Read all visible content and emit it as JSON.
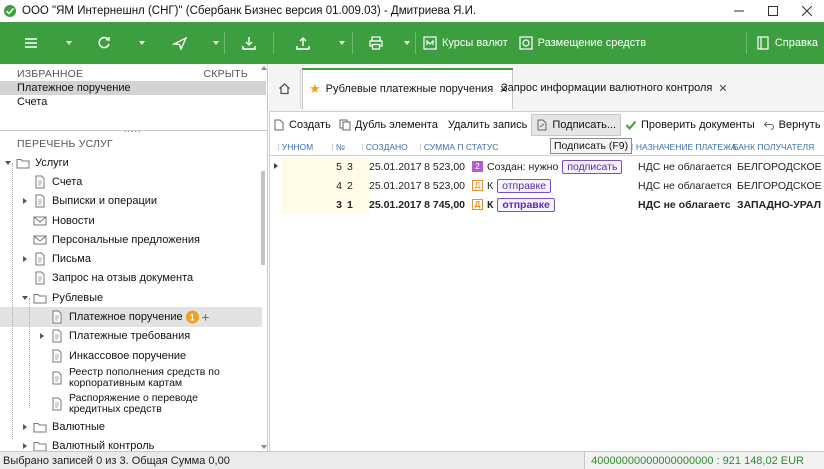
{
  "window": {
    "title": "ООО \"ЯМ Интернешнл (СНГ)\" (Сбербанк Бизнес версия 01.009.03) - Дмитриева Я.И.",
    "controls": [
      "minimize",
      "maximize",
      "close"
    ]
  },
  "toolbar": {
    "rates_label": "Курсы валют",
    "deposit_label": "Размещение средств",
    "help_label": "Справка"
  },
  "favorites": {
    "header": "ИЗБРАННОЕ",
    "collapse_label": "СКРЫТЬ",
    "items": [
      "Платежное поручение",
      "Счета"
    ],
    "selected_index": 0
  },
  "services": {
    "header": "ПЕРЕЧЕНЬ УСЛУГ",
    "items": [
      {
        "label": "Услуги",
        "level": 0,
        "expander": "open"
      },
      {
        "label": "Счета",
        "level": 1,
        "expander": ""
      },
      {
        "label": "Выписки и операции",
        "level": 1,
        "expander": "closed"
      },
      {
        "label": "Новости",
        "level": 1,
        "expander": ""
      },
      {
        "label": "Персональные предложения",
        "level": 1,
        "expander": ""
      },
      {
        "label": "Письма",
        "level": 1,
        "expander": "closed"
      },
      {
        "label": "Запрос на отзыв документа",
        "level": 1,
        "expander": ""
      },
      {
        "label": "Рублевые",
        "level": 1,
        "expander": "open"
      },
      {
        "label": "Платежное поручение",
        "level": 2,
        "expander": "",
        "badge": "1",
        "selected": true
      },
      {
        "label": "Платежные требования",
        "level": 2,
        "expander": "closed"
      },
      {
        "label": "Инкассовое поручение",
        "level": 2,
        "expander": ""
      },
      {
        "label": "Реестр пополнения средств по корпоративным картам",
        "level": 2,
        "expander": "",
        "two_line": true
      },
      {
        "label": "Распоряжение о переводе кредитных средств",
        "level": 2,
        "expander": "",
        "two_line": true
      },
      {
        "label": "Валютные",
        "level": 1,
        "expander": "closed"
      },
      {
        "label": "Валютный контроль",
        "level": 1,
        "expander": "closed"
      }
    ]
  },
  "tabs": [
    {
      "label": "Рублевые платежные поручения",
      "active": true,
      "starred": true
    },
    {
      "label": "Запрос информации валютного контроля",
      "active": false,
      "starred": false
    }
  ],
  "actions": {
    "create": "Создать",
    "duplicate": "Дубль элемента",
    "delete": "Удалить запись",
    "sign": "Подписать...",
    "check": "Проверить документы",
    "return": "Вернуть предыду"
  },
  "tooltip": "Подписать (F9)",
  "grid": {
    "columns": [
      "УННОМ",
      "№",
      "СОЗДАНО",
      "СУММА П",
      "СТАТУС",
      "НАЗНАЧЕНИЕ ПЛАТЕЖА",
      "БАНК ПОЛУЧАТЕЛЯ"
    ],
    "rows": [
      {
        "unnom": "5",
        "num": "3",
        "created": "25.01.2017",
        "sum": "8 523,00",
        "status_icon": "2",
        "status_text": "Создан: нужно",
        "status_tag": "подписать",
        "purpose": "НДС не облагается",
        "bank": "БЕЛГОРОДСКОЕ О",
        "bold": false,
        "current": true
      },
      {
        "unnom": "4",
        "num": "2",
        "created": "25.01.2017",
        "sum": "8 523,00",
        "status_icon": "Д",
        "status_text": "К",
        "status_tag": "отправке",
        "purpose": "НДС не облагается",
        "bank": "БЕЛГОРОДСКОЕ О",
        "bold": false,
        "current": false
      },
      {
        "unnom": "3",
        "num": "1",
        "created": "25.01.2017",
        "sum": "8 745,00",
        "status_icon": "Д",
        "status_text": "К",
        "status_tag": "отправке",
        "purpose": "НДС не облагаетс",
        "bank": "ЗАПАДНО-УРАЛ",
        "bold": true,
        "current": false
      }
    ]
  },
  "status": {
    "left": "Выбрано записей 0 из 3. Общая Сумма 0,00",
    "right": "40000000000000000000 : 921 148,02 EUR"
  }
}
